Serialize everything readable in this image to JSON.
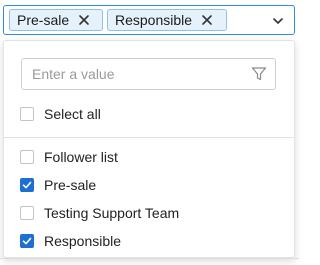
{
  "colors": {
    "accent": "#2f8ae2",
    "checkbox_checked": "#1d6fd1",
    "tag_bg": "#e6f2fb"
  },
  "select": {
    "tags": [
      {
        "label": "Pre-sale",
        "remove_icon": "close-icon"
      },
      {
        "label": "Responsible",
        "remove_icon": "close-icon"
      }
    ],
    "toggle_icon": "chevron-down-icon"
  },
  "dropdown": {
    "search": {
      "placeholder": "Enter a value",
      "value": "",
      "icon": "filter-icon"
    },
    "select_all": {
      "label": "Select all",
      "checked": false
    },
    "options": [
      {
        "label": "Follower list",
        "checked": false
      },
      {
        "label": "Pre-sale",
        "checked": true
      },
      {
        "label": "Testing Support Team",
        "checked": false
      },
      {
        "label": "Responsible",
        "checked": true
      }
    ]
  }
}
